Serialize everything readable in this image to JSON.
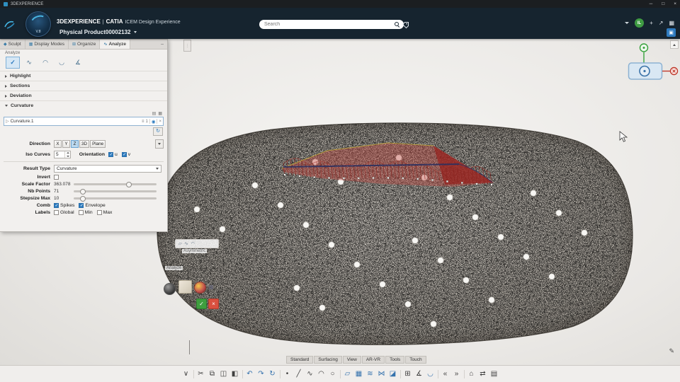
{
  "titlebar": {
    "app": "3DEXPERIENCE"
  },
  "appbar": {
    "brand": "3DEXPERIENCE",
    "divider": "|",
    "app_bold": "CATIA",
    "app_name": "ICEM Design Experience",
    "search_placeholder": "Search",
    "user_initials": "IL"
  },
  "docbar": {
    "title": "Physical Product00002132",
    "version": "V.8"
  },
  "panel": {
    "tabs": [
      {
        "label": "Sculpt"
      },
      {
        "label": "Display Modes"
      },
      {
        "label": "Organize"
      },
      {
        "label": "Analyze"
      }
    ],
    "group_label": "Analyze",
    "tool_icons": [
      {
        "name": "curvature-check",
        "glyph": "✓"
      },
      {
        "name": "comb-analysis",
        "glyph": "∿"
      },
      {
        "name": "section-analysis",
        "glyph": "◠"
      },
      {
        "name": "distance-analysis",
        "glyph": "◡"
      },
      {
        "name": "draft-analysis",
        "glyph": "∡"
      }
    ],
    "sections": [
      {
        "label": "Highlight"
      },
      {
        "label": "Sections"
      },
      {
        "label": "Deviation"
      },
      {
        "label": "Curvature"
      }
    ],
    "curvature": {
      "feature_name": "Curvature.1",
      "count": "1",
      "direction_label": "Direction",
      "directions": [
        "X",
        "Y",
        "Z",
        "3D",
        "Plane"
      ],
      "iso_label": "Iso Curves",
      "iso_value": "5",
      "orientation_label": "Orientation",
      "u_label": "u",
      "v_label": "v",
      "result_label": "Result Type",
      "result_value": "Curvature",
      "invert_label": "Invert",
      "scale_label": "Scale Factor",
      "scale_value": "363.078",
      "nbpoints_label": "Nb Points",
      "nbpoints_value": "71",
      "stepsize_label": "Stepsize Max",
      "stepsize_value": "10",
      "comb_label": "Comb",
      "spikes_label": "Spikes",
      "envelope_label": "Envelope",
      "labels_label": "Labels",
      "global_label": "Global",
      "min_label": "Min",
      "max_label": "Max"
    }
  },
  "canvas": {
    "context": {
      "asymmetric": "Asymmetric",
      "analyze": "Analyze"
    }
  },
  "bottom": {
    "tabs": [
      "Standard",
      "Surfacing",
      "View",
      "AR-VR",
      "Tools",
      "Touch"
    ],
    "icons": [
      {
        "name": "toolbar-overflow-icon",
        "glyph": "∨"
      },
      {
        "sep": true
      },
      {
        "name": "cut-icon",
        "glyph": "✂"
      },
      {
        "name": "copy-icon",
        "glyph": "⧉"
      },
      {
        "name": "paste-icon",
        "glyph": "◫"
      },
      {
        "name": "format-paint-icon",
        "glyph": "◧"
      },
      {
        "sep": true
      },
      {
        "name": "undo-icon",
        "glyph": "↶",
        "blue": true
      },
      {
        "name": "redo-icon",
        "glyph": "↷",
        "blue": true
      },
      {
        "name": "refresh-icon",
        "glyph": "↻",
        "blue": true
      },
      {
        "sep": true
      },
      {
        "name": "point-icon",
        "glyph": "•"
      },
      {
        "name": "line-icon",
        "glyph": "╱"
      },
      {
        "name": "spline-icon",
        "glyph": "∿"
      },
      {
        "name": "arc-icon",
        "glyph": "◠"
      },
      {
        "name": "circle-icon",
        "glyph": "○"
      },
      {
        "sep": true
      },
      {
        "name": "plane-icon",
        "glyph": "▱",
        "blue": true
      },
      {
        "name": "surface-icon",
        "glyph": "▦",
        "blue": true
      },
      {
        "name": "loft-icon",
        "glyph": "≋",
        "blue": true
      },
      {
        "name": "blend-icon",
        "glyph": "⋈",
        "blue": true
      },
      {
        "name": "patch-icon",
        "glyph": "◪",
        "blue": true
      },
      {
        "sep": true
      },
      {
        "name": "match-icon",
        "glyph": "⊞"
      },
      {
        "name": "draft-analysis-icon",
        "glyph": "∡"
      },
      {
        "name": "comb-analysis-icon",
        "glyph": "◡",
        "blue": true
      },
      {
        "sep": true
      },
      {
        "name": "rewind-icon",
        "glyph": "«"
      },
      {
        "name": "fast-forward-icon",
        "glyph": "»"
      },
      {
        "sep": true
      },
      {
        "name": "home-icon",
        "glyph": "⌂"
      },
      {
        "name": "swap-view-icon",
        "glyph": "⇄"
      },
      {
        "name": "list-icon",
        "glyph": "▤"
      }
    ]
  },
  "icons": {
    "minimize": "─",
    "maximize": "□",
    "close": "×",
    "add": "+",
    "share": "↗",
    "apps": "▦",
    "expand": "▣",
    "collapse": "–",
    "tab_sculpt": "◆",
    "tab_display": "▦",
    "tab_organize": "⊞",
    "tab_analyze": "∿",
    "layers": "▤",
    "grid": "▦",
    "play": "▷",
    "filter": "≡",
    "eye": "◉",
    "remove": "×",
    "refresh": "↻",
    "pencil": "✎",
    "check": "✓",
    "cross": "×",
    "mini1": "▱",
    "mini2": "∿",
    "mini3": "◠",
    "handle": "⋮",
    "corner": "▴"
  }
}
